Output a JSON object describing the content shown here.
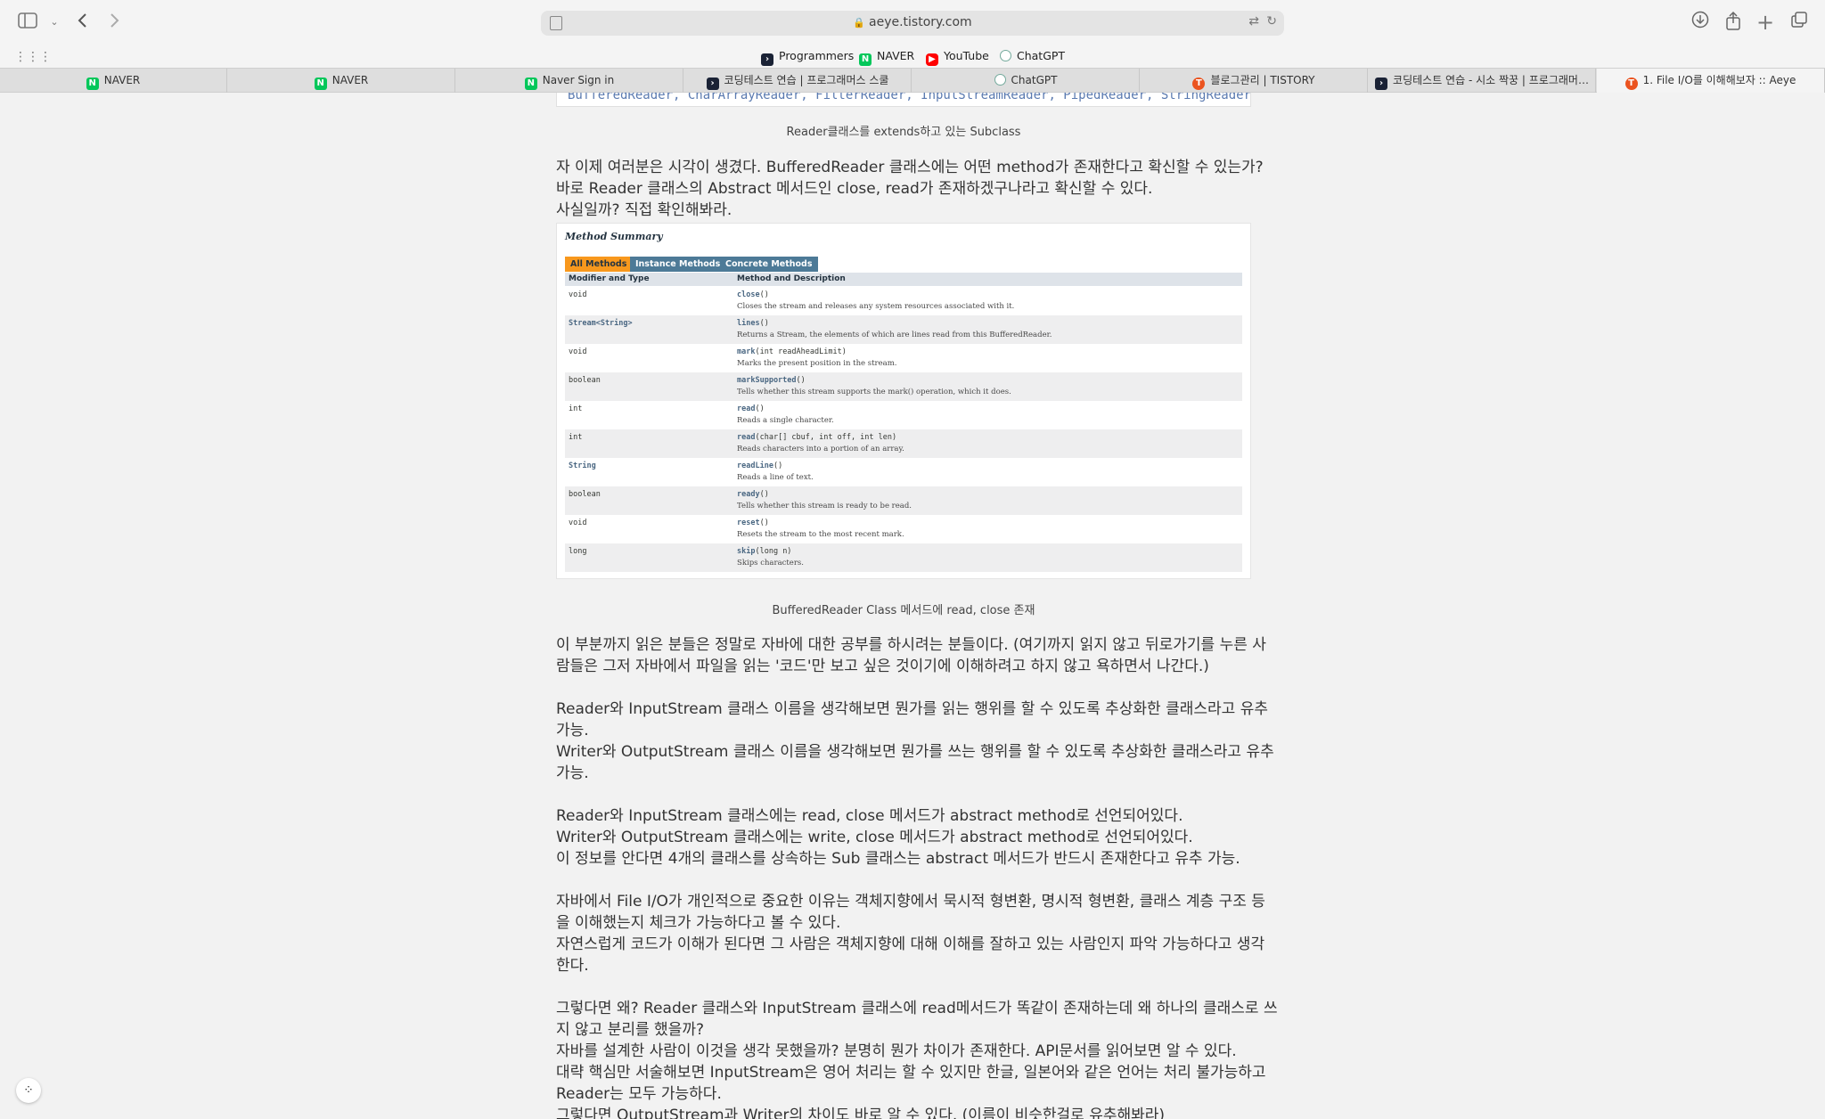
{
  "browser": {
    "url": "aeye.tistory.com",
    "bookmarks": [
      {
        "label": "Programmers",
        "icon": "programmers-favicon"
      },
      {
        "label": "NAVER",
        "icon": "naver-favicon"
      },
      {
        "label": "YouTube",
        "icon": "youtube-favicon"
      },
      {
        "label": "ChatGPT",
        "icon": "chatgpt-favicon"
      }
    ],
    "tabs": [
      {
        "label": "NAVER"
      },
      {
        "label": "NAVER"
      },
      {
        "label": "Naver Sign in"
      },
      {
        "label": "코딩테스트 연습 | 프로그래머스 스쿨"
      },
      {
        "label": "ChatGPT"
      },
      {
        "label": "블로그관리 | TISTORY"
      },
      {
        "label": "코딩테스트 연습 - 시소 짝꿍 | 프로그래머…"
      },
      {
        "label": "1. File I/O를 이해해보자 :: Aeye"
      }
    ]
  },
  "article": {
    "code_top": "BufferedReader, CharArrayReader, FilterReader, InputStreamReader, PipedReader, StringReader",
    "caption1": "Reader클래스를 extends하고 있는 Subclass",
    "para1": [
      "자 이제 여러분은 시각이 생겼다. BufferedReader 클래스에는 어떤 method가 존재한다고 확신할 수 있는가?",
      "바로 Reader 클래스의 Abstract 메서드인 close, read가 존재하겠구나라고 확신할 수 있다.",
      "사실일까? 직접 확인해봐라."
    ],
    "method_summary": {
      "title": "Method Summary",
      "tabs": [
        "All Methods",
        "Instance Methods",
        "Concrete Methods"
      ],
      "col1": "Modifier and Type",
      "col2": "Method and Description",
      "rows": [
        {
          "type": "void",
          "name": "close",
          "params": "()",
          "desc": "Closes the stream and releases any system resources associated with it."
        },
        {
          "type": "Stream<String>",
          "name": "lines",
          "params": "()",
          "desc": "Returns a Stream, the elements of which are lines read from this BufferedReader."
        },
        {
          "type": "void",
          "name": "mark",
          "params": "(int readAheadLimit)",
          "desc": "Marks the present position in the stream."
        },
        {
          "type": "boolean",
          "name": "markSupported",
          "params": "()",
          "desc": "Tells whether this stream supports the mark() operation, which it does."
        },
        {
          "type": "int",
          "name": "read",
          "params": "()",
          "desc": "Reads a single character."
        },
        {
          "type": "int",
          "name": "read",
          "params": "(char[] cbuf, int off, int len)",
          "desc": "Reads characters into a portion of an array."
        },
        {
          "type": "String",
          "name": "readLine",
          "params": "()",
          "desc": "Reads a line of text."
        },
        {
          "type": "boolean",
          "name": "ready",
          "params": "()",
          "desc": "Tells whether this stream is ready to be read."
        },
        {
          "type": "void",
          "name": "reset",
          "params": "()",
          "desc": "Resets the stream to the most recent mark."
        },
        {
          "type": "long",
          "name": "skip",
          "params": "(long n)",
          "desc": "Skips characters."
        }
      ]
    },
    "caption2": "BufferedReader Class 메서드에 read, close 존재",
    "para2": [
      "이 부분까지 읽은 분들은 정말로 자바에 대한 공부를 하시려는 분들이다. (여기까지 읽지 않고 뒤로가기를 누른 사",
      "람들은 그저 자바에서 파일을 읽는 '코드'만 보고 싶은 것이기에 이해하려고 하지 않고 욕하면서 나간다.)"
    ],
    "para3": [
      "Reader와 InputStream 클래스 이름을 생각해보면 뭔가를 읽는 행위를 할 수 있도록 추상화한 클래스라고 유추",
      "가능.",
      "Writer와 OutputStream 클래스 이름을 생각해보면 뭔가를 쓰는 행위를 할 수 있도록 추상화한 클래스라고 유추",
      "가능."
    ],
    "para4": [
      "Reader와 InputStream 클래스에는 read, close 메서드가 abstract method로 선언되어있다.",
      "Writer와 OutputStream 클래스에는 write, close 메서드가 abstract method로 선언되어있다.",
      "이 정보를 안다면 4개의 클래스를 상속하는 Sub 클래스는 abstract 메서드가 반드시 존재한다고 유추 가능."
    ],
    "para5": [
      "자바에서 File I/O가 개인적으로 중요한 이유는 객체지향에서 묵시적 형변환, 명시적 형변환, 클래스 계층 구조 등",
      "을 이해했는지 체크가 가능하다고 볼 수 있다.",
      "자연스럽게 코드가 이해가 된다면 그 사람은 객체지향에 대해 이해를 잘하고 있는 사람인지 파악 가능하다고 생각",
      "한다."
    ],
    "para6": [
      "그렇다면 왜? Reader 클래스와 InputStream 클래스에 read메서드가 똑같이 존재하는데 왜 하나의 클래스로 쓰",
      "지 않고 분리를 했을까?",
      "자바를 설계한 사람이 이것을 생각 못했을까? 분명히 뭔가 차이가 존재한다. API문서를 읽어보면 알 수 있다.",
      "대략 핵심만 서술해보면 InputStream은 영어 처리는 할 수 있지만 한글, 일본어와 같은 언어는 처리 불가능하고",
      "Reader는 모두 가능하다.",
      "그렇다면 OutputStream과 Writer의 차이도 바로 알 수 있다. (이름이 비슷한걸로 유추해봐라)"
    ]
  }
}
